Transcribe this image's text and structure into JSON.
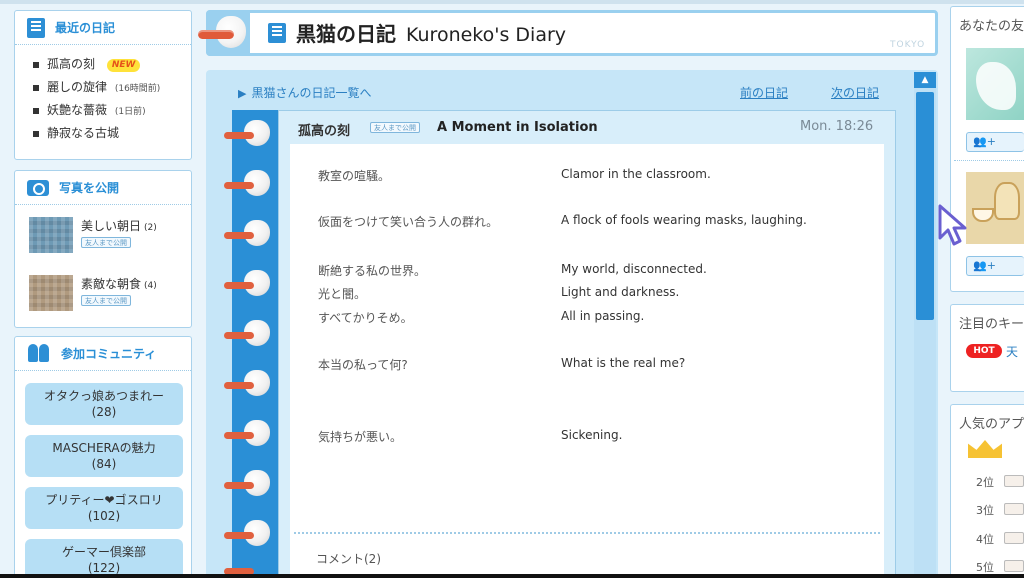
{
  "sidebar": {
    "recent": {
      "title": "最近の日記",
      "items": [
        {
          "label": "孤高の刻",
          "badge": "NEW"
        },
        {
          "label": "麗しの旋律",
          "meta": "(16時間前)"
        },
        {
          "label": "妖艶な薔薇",
          "meta": "(1日前)"
        },
        {
          "label": "静寂なる古城"
        }
      ]
    },
    "photos": {
      "title": "写真を公開",
      "items": [
        {
          "title": "美しい朝日",
          "count": "(2)",
          "tag": "友人まで公開"
        },
        {
          "title": "素敵な朝食",
          "count": "(4)",
          "tag": "友人まで公開"
        }
      ]
    },
    "community": {
      "title": "参加コミュニティ",
      "items": [
        {
          "name": "オタクっ娘あつまれー",
          "count": "(28)"
        },
        {
          "name": "MASCHERAの魅力",
          "count": "(84)"
        },
        {
          "name": "プリティー❤ゴスロリ",
          "count": "(102)"
        },
        {
          "name": "ゲーマー倶楽部",
          "count": "(122)"
        }
      ]
    }
  },
  "header": {
    "title_jp": "黒猫の日記",
    "title_en": "Kuroneko's Diary",
    "watermark": "TOKYO"
  },
  "nav": {
    "back_link": "黒猫さんの日記一覧へ",
    "prev": "前の日記",
    "next": "次の日記"
  },
  "entry": {
    "title_jp": "孤高の刻",
    "visibility": "友人まで公開",
    "title_en": "A Moment in Isolation",
    "timestamp": "Mon. 18:26",
    "lines": [
      {
        "jp": "教室の喧騒。",
        "en": "Clamor in the classroom."
      },
      {
        "jp": "仮面をつけて笑い合う人の群れ。",
        "en": "A flock of fools wearing masks, laughing."
      },
      {
        "jp": "断絶する私の世界。",
        "en": "My world, disconnected."
      },
      {
        "jp": "光と闇。",
        "en": "Light and darkness."
      },
      {
        "jp": "すべてかりそめ。",
        "en": "All in passing."
      },
      {
        "jp": "本当の私って何?",
        "en": "What is the real me?"
      },
      {
        "jp": "気持ちが悪い。",
        "en": "Sickening."
      }
    ],
    "comments_label": "コメント(2)"
  },
  "right": {
    "you_title": "あなたの友",
    "keyword_title": "注目のキー",
    "hot_badge": "HOT",
    "hot_text": "天",
    "popular_title": "人気のアプ",
    "ranks": [
      "2位",
      "3位",
      "4位",
      "5位"
    ],
    "add_label": "+",
    "icons": [
      "add-friend-icon",
      "add-friend-icon",
      "crown-icon"
    ]
  },
  "colors": {
    "accent": "#2a8fd6",
    "panel_border": "#a9d2ec",
    "ring": "#e0603f",
    "content_bg": "#c6e6f8"
  }
}
